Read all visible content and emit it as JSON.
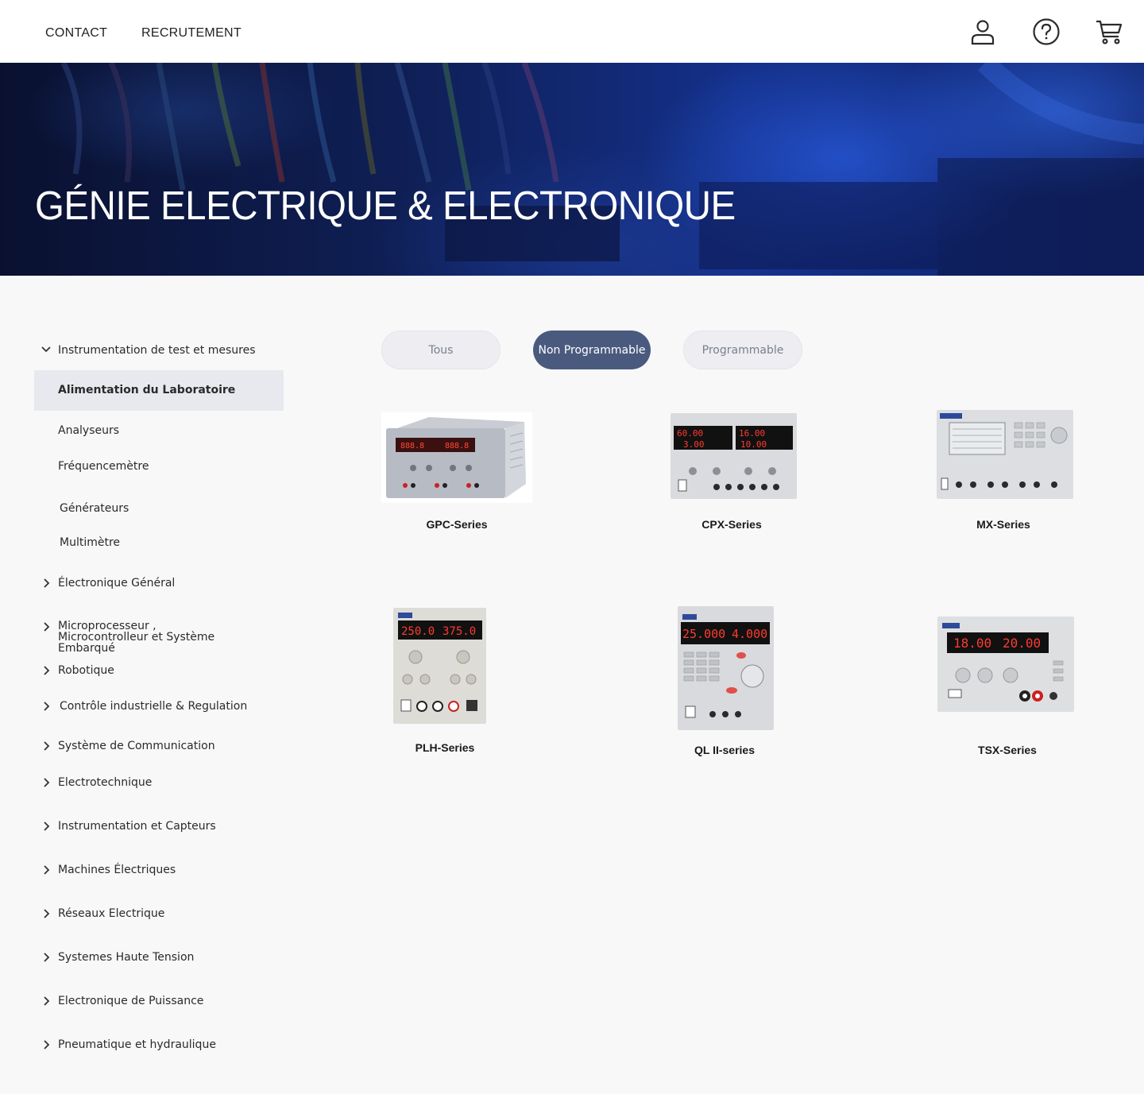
{
  "header": {
    "nav": [
      {
        "label": "CONTACT"
      },
      {
        "label": "RECRUTEMENT"
      }
    ],
    "icons": [
      "user-icon",
      "help-icon",
      "cart-icon"
    ]
  },
  "hero": {
    "title": "GÉNIE ELECTRIQUE & ELECTRONIQUE"
  },
  "sidebar": {
    "expanded_category": "Instrumentation de test et mesures",
    "subitems": [
      {
        "label": "Alimentation du Laboratoire",
        "active": true
      },
      {
        "label": "Analyseurs"
      },
      {
        "label": "Fréquencemètre"
      },
      {
        "label": "Générateurs"
      },
      {
        "label": "Multimètre"
      }
    ],
    "categories": [
      {
        "label": "Électronique Général"
      },
      {
        "label": "Microprocesseur , Microcontrolleur et Système Embarqué"
      },
      {
        "label": "Robotique"
      },
      {
        "label": "Contrôle industrielle & Regulation"
      },
      {
        "label": "Système de Communication"
      },
      {
        "label": "Electrotechnique"
      },
      {
        "label": "Instrumentation et Capteurs"
      },
      {
        "label": "Machines Électriques"
      },
      {
        "label": "Réseaux Electrique"
      },
      {
        "label": "Systemes Haute Tension"
      },
      {
        "label": "Electronique de Puissance"
      },
      {
        "label": "Pneumatique et hydraulique"
      }
    ]
  },
  "filters": {
    "options": [
      {
        "label": "Tous"
      },
      {
        "label": "Non Programmable",
        "selected": true
      },
      {
        "label": "Programmable"
      }
    ]
  },
  "products": [
    {
      "name": "GPC-Series",
      "display": [
        "",
        ""
      ]
    },
    {
      "name": "CPX-Series",
      "display": [
        "60.00",
        "16.00",
        "3.00",
        "10.00"
      ]
    },
    {
      "name": "MX-Series",
      "display": []
    },
    {
      "name": "PLH-Series",
      "display": [
        "250.0",
        "375.0"
      ]
    },
    {
      "name": "QL II-series",
      "display": [
        "25.000",
        "4.000"
      ]
    },
    {
      "name": "TSX-Series",
      "display": [
        "18.00",
        "20.00"
      ]
    }
  ],
  "colors": {
    "accent": "#4a5a7e",
    "active_bg": "#e8e9ee",
    "page_bg": "#f8f8f8",
    "display_red": "#ff3b2f"
  }
}
